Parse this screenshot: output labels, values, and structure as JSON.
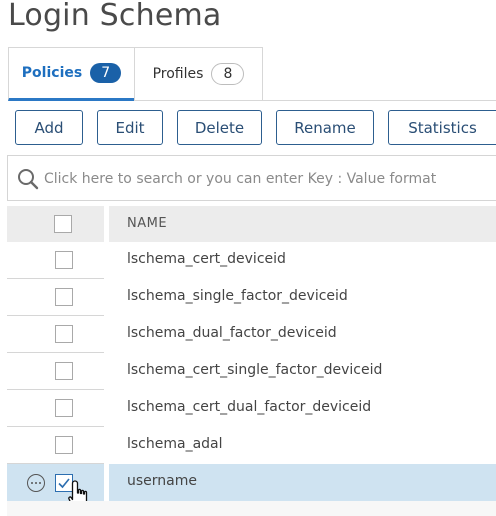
{
  "page": {
    "title": "Login Schema"
  },
  "tabs": [
    {
      "label": "Policies",
      "count": "7",
      "active": true
    },
    {
      "label": "Profiles",
      "count": "8",
      "active": false
    }
  ],
  "toolbar": {
    "add_label": "Add",
    "edit_label": "Edit",
    "delete_label": "Delete",
    "rename_label": "Rename",
    "statistics_label": "Statistics"
  },
  "search": {
    "placeholder": "Click here to search or you can enter Key : Value format",
    "icon": "search-icon"
  },
  "table": {
    "header_name": "NAME",
    "rows": [
      {
        "name": "lschema_cert_deviceid",
        "checked": false
      },
      {
        "name": "lschema_single_factor_deviceid",
        "checked": false
      },
      {
        "name": "lschema_dual_factor_deviceid",
        "checked": false
      },
      {
        "name": "lschema_cert_single_factor_deviceid",
        "checked": false
      },
      {
        "name": "lschema_cert_dual_factor_deviceid",
        "checked": false
      },
      {
        "name": "lschema_adal",
        "checked": false
      },
      {
        "name": "username",
        "checked": true
      }
    ]
  },
  "colors": {
    "accent": "#1a61a8",
    "selected_row": "#cfe3f1",
    "button_border": "#2d5e8f"
  }
}
